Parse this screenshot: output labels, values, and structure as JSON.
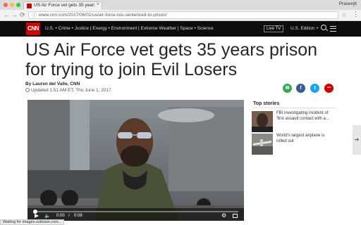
{
  "browser": {
    "tab_title": "US Air Force vet gets 35 years ...",
    "tab_close": "×",
    "profile_name": "Prasenjit",
    "url": "www.cnn.com/2017/06/01/us/air-force-isis-sentenced-to-prison/",
    "back_icon": "←",
    "forward_icon": "→",
    "reload_icon": "⟳",
    "star_icon": "☆",
    "menu_icon": "⋮",
    "status_text": "Waiting for images.outbrain.com..."
  },
  "cnn_nav": {
    "logo": "CNN",
    "links": "U.S. • Crime • Justice | Energy • Environment | Extreme Weather | Space • Science",
    "live_tv": "Live TV",
    "edition": "U.S. Edition +",
    "brand_color": "#cc0000"
  },
  "article": {
    "headline": "US Air Force vet gets 35 years prison for trying to join Evil Losers",
    "byline": "By Lauren del Valle, CNN",
    "updated": "Updated 1:51 AM ET, Thu June 1, 2017",
    "share_icons": [
      {
        "icon": "email-icon",
        "glyph": "✉",
        "color": "#3aa757"
      },
      {
        "icon": "facebook-icon",
        "glyph": "f",
        "color": "#3b5998"
      },
      {
        "icon": "twitter-icon",
        "glyph": "t",
        "color": "#1da1f2"
      },
      {
        "icon": "more-icon",
        "glyph": "•••",
        "color": "#cc0000"
      }
    ]
  },
  "video": {
    "current_time": "0:00",
    "separator": "/",
    "duration": "0:08",
    "progress": 0.0
  },
  "top_stories": {
    "header": "Top stories",
    "items": [
      {
        "text": "FBI investigating incident of 'first assault contact with a..."
      },
      {
        "text": "World's largest airplane is rolled out"
      }
    ]
  },
  "next_arrow": "➔"
}
